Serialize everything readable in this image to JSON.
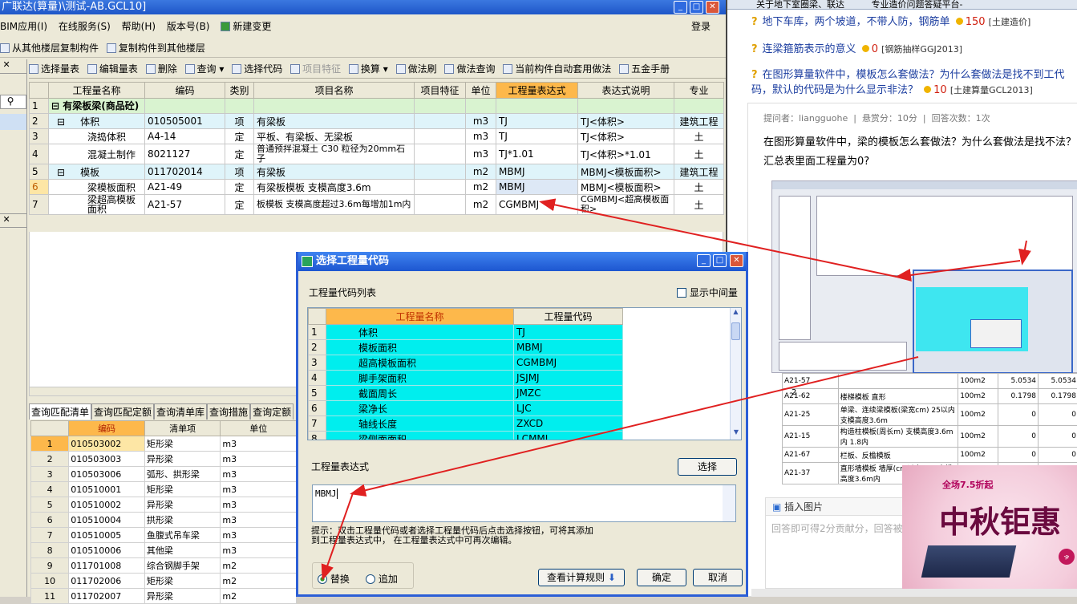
{
  "app": {
    "title": "广联达(算量)\\测试-AB.GCL10]",
    "menu": [
      "BIM应用(I)",
      "在线服务(S)",
      "帮助(H)",
      "版本号(B)",
      "新建变更"
    ],
    "login": "登录",
    "toolbar1": [
      "从其他楼层复制构件",
      "复制构件到其他楼层"
    ],
    "toolbar2": [
      "选择量表",
      "编辑量表",
      "删除",
      "查询",
      "选择代码",
      "项目特征",
      "换算",
      "做法刷",
      "做法查询",
      "当前构件自动套用做法",
      "五金手册"
    ]
  },
  "grid": {
    "headers": [
      "工程量名称",
      "编码",
      "类别",
      "项目名称",
      "项目特征",
      "单位",
      "工程量表达式",
      "表达式说明",
      "专业"
    ],
    "rows": [
      {
        "n": "1",
        "name": "有梁板梁(商品砼)",
        "code": "",
        "cat": "",
        "proj": "",
        "feat": "",
        "unit": "",
        "expr": "",
        "desc": "",
        "spec": ""
      },
      {
        "n": "2",
        "name": "体积",
        "code": "010505001",
        "cat": "项",
        "proj": "有梁板",
        "feat": "",
        "unit": "m3",
        "expr": "TJ",
        "desc": "TJ<体积>",
        "spec": "建筑工程"
      },
      {
        "n": "3",
        "name": "浇捣体积",
        "code": "A4-14",
        "cat": "定",
        "proj": "平板、有梁板、无梁板",
        "feat": "",
        "unit": "m3",
        "expr": "TJ",
        "desc": "TJ<体积>",
        "spec": "土"
      },
      {
        "n": "4",
        "name": "混凝土制作",
        "code": "8021127",
        "cat": "定",
        "proj": "普通预拌混凝土 C30 粒径为20mm石子",
        "feat": "",
        "unit": "m3",
        "expr": "TJ*1.01",
        "desc": "TJ<体积>*1.01",
        "spec": "土"
      },
      {
        "n": "5",
        "name": "模板",
        "code": "011702014",
        "cat": "项",
        "proj": "有梁板",
        "feat": "",
        "unit": "m2",
        "expr": "MBMJ",
        "desc": "MBMJ<模板面积>",
        "spec": "建筑工程"
      },
      {
        "n": "6",
        "name": "梁模板面积",
        "code": "A21-49",
        "cat": "定",
        "proj": "有梁板模板 支模高度3.6m",
        "feat": "",
        "unit": "m2",
        "expr": "MBMJ",
        "desc": "MBMJ<模板面积>",
        "spec": "土"
      },
      {
        "n": "7",
        "name": "梁超高模板面积",
        "code": "A21-57",
        "cat": "定",
        "proj": "板模板 支模高度超过3.6m每增加1m内",
        "feat": "",
        "unit": "m2",
        "expr": "CGMBMJ",
        "desc": "CGMBMJ<超高模板面积>",
        "spec": "土"
      }
    ]
  },
  "bottom": {
    "tabs": [
      "查询匹配清单",
      "查询匹配定额",
      "查询清单库",
      "查询措施",
      "查询定额"
    ],
    "headers": [
      "编码",
      "清单项",
      "单位"
    ],
    "rows": [
      [
        "1",
        "010503002",
        "矩形梁",
        "m3"
      ],
      [
        "2",
        "010503003",
        "异形梁",
        "m3"
      ],
      [
        "3",
        "010503006",
        "弧形、拱形梁",
        "m3"
      ],
      [
        "4",
        "010510001",
        "矩形梁",
        "m3"
      ],
      [
        "5",
        "010510002",
        "异形梁",
        "m3"
      ],
      [
        "6",
        "010510004",
        "拱形梁",
        "m3"
      ],
      [
        "7",
        "010510005",
        "鱼腹式吊车梁",
        "m3"
      ],
      [
        "8",
        "010510006",
        "其他梁",
        "m3"
      ],
      [
        "9",
        "011701008",
        "综合钢脚手架",
        "m2"
      ],
      [
        "10",
        "011702006",
        "矩形梁",
        "m2"
      ],
      [
        "11",
        "011702007",
        "异形梁",
        "m2"
      ]
    ]
  },
  "dialog": {
    "title": "选择工程量代码",
    "list_label": "工程量代码列表",
    "show_middle": "显示中间量",
    "headers": [
      "工程量名称",
      "工程量代码"
    ],
    "rows": [
      [
        "1",
        "体积",
        "TJ"
      ],
      [
        "2",
        "模板面积",
        "MBMJ"
      ],
      [
        "3",
        "超高模板面积",
        "CGMBMJ"
      ],
      [
        "4",
        "脚手架面积",
        "JSJMJ"
      ],
      [
        "5",
        "截面周长",
        "JMZC"
      ],
      [
        "6",
        "梁净长",
        "LJC"
      ],
      [
        "7",
        "轴线长度",
        "ZXCD"
      ],
      [
        "8",
        "梁侧面面积",
        "LCMMJ"
      ]
    ],
    "expr_label": "工程量表达式",
    "select_btn": "选择",
    "expr_value": "MBMJ",
    "hint": "提示：双击工程量代码或者选择工程量代码后点击选择按钮，可将其添加到工程量表达式中， 在工程量表达式中可再次编辑。",
    "radio_replace": "替换",
    "radio_append": "追加",
    "view_rules": "查看计算规则",
    "ok": "确定",
    "cancel": "取消"
  },
  "web": {
    "tab1": "关于地下室圈梁、联达",
    "tab2": "专业造价问题答疑平台-",
    "q1": "地下车库，两个坡道，不带人防，钢筋单",
    "q1_score": "150",
    "q1_tag": "[土建造价]",
    "q2": "连梁箍筋表示的意义",
    "q2_score": "0",
    "q2_tag": "[钢筋抽样GGJ2013]",
    "q3": "在图形算量软件中，模板怎么套做法？为什么套做法是找不到工代码，默认的代码是为什么显示非法？",
    "q3_score": "10",
    "q3_tag": "[土建算量GCL2013]",
    "asker": "提问者：liangguohe",
    "bounty": "悬赏分：10分",
    "answers": "回答次数：1次",
    "body": "在图形算量软件中，梁的模板怎么套做法？为什么套做法是找不法？汇总表里面工程量为0?",
    "insert_image": "插入图片",
    "answer_hint": "回答即可得2分贡献分，回答被",
    "ad_main": "中秋钜惠",
    "ad_sub": "全场7.5折起",
    "preview_rows": [
      [
        "A21-57",
        "",
        "100m2",
        "5.0534",
        "5.0534"
      ],
      [
        "A21-62",
        "楼梯模板 直形",
        "100m2",
        "0.1798",
        "0.1798"
      ],
      [
        "A21-25",
        "单梁、连续梁模板(梁宽cm) 25以内 支模高度3.6m",
        "100m2",
        "0",
        "0"
      ],
      [
        "A21-15",
        "构造柱模板(周长m) 支模高度3.6m内 1.8内",
        "100m2",
        "0",
        "0"
      ],
      [
        "A21-67",
        "栏板、反檐模板",
        "100m2",
        "0",
        "0"
      ],
      [
        "A21-37",
        "直形墙模板 墙厚(cm以内) 40 支模高度3.6m内",
        "100m2",
        "0",
        "0"
      ]
    ]
  }
}
